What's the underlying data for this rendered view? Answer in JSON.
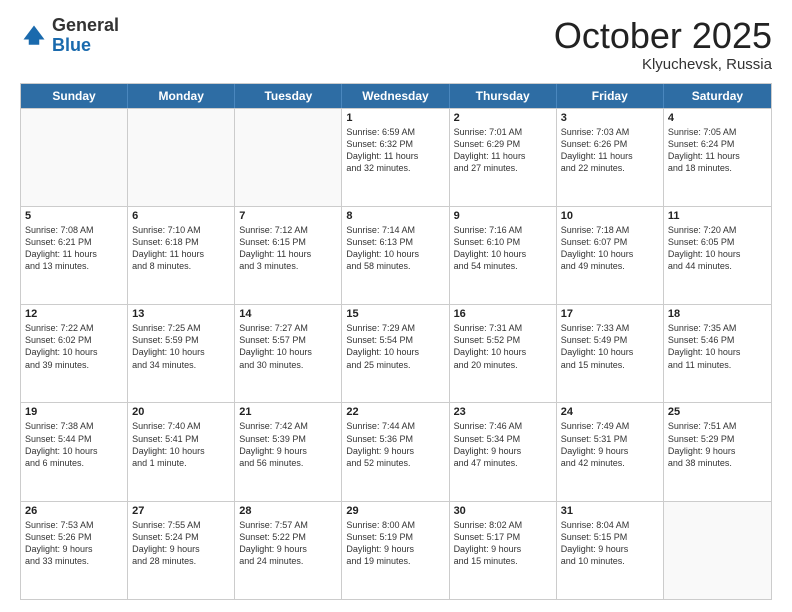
{
  "header": {
    "logo_general": "General",
    "logo_blue": "Blue",
    "month": "October 2025",
    "location": "Klyuchevsk, Russia"
  },
  "days_of_week": [
    "Sunday",
    "Monday",
    "Tuesday",
    "Wednesday",
    "Thursday",
    "Friday",
    "Saturday"
  ],
  "weeks": [
    [
      {
        "day": "",
        "text": ""
      },
      {
        "day": "",
        "text": ""
      },
      {
        "day": "",
        "text": ""
      },
      {
        "day": "1",
        "text": "Sunrise: 6:59 AM\nSunset: 6:32 PM\nDaylight: 11 hours\nand 32 minutes."
      },
      {
        "day": "2",
        "text": "Sunrise: 7:01 AM\nSunset: 6:29 PM\nDaylight: 11 hours\nand 27 minutes."
      },
      {
        "day": "3",
        "text": "Sunrise: 7:03 AM\nSunset: 6:26 PM\nDaylight: 11 hours\nand 22 minutes."
      },
      {
        "day": "4",
        "text": "Sunrise: 7:05 AM\nSunset: 6:24 PM\nDaylight: 11 hours\nand 18 minutes."
      }
    ],
    [
      {
        "day": "5",
        "text": "Sunrise: 7:08 AM\nSunset: 6:21 PM\nDaylight: 11 hours\nand 13 minutes."
      },
      {
        "day": "6",
        "text": "Sunrise: 7:10 AM\nSunset: 6:18 PM\nDaylight: 11 hours\nand 8 minutes."
      },
      {
        "day": "7",
        "text": "Sunrise: 7:12 AM\nSunset: 6:15 PM\nDaylight: 11 hours\nand 3 minutes."
      },
      {
        "day": "8",
        "text": "Sunrise: 7:14 AM\nSunset: 6:13 PM\nDaylight: 10 hours\nand 58 minutes."
      },
      {
        "day": "9",
        "text": "Sunrise: 7:16 AM\nSunset: 6:10 PM\nDaylight: 10 hours\nand 54 minutes."
      },
      {
        "day": "10",
        "text": "Sunrise: 7:18 AM\nSunset: 6:07 PM\nDaylight: 10 hours\nand 49 minutes."
      },
      {
        "day": "11",
        "text": "Sunrise: 7:20 AM\nSunset: 6:05 PM\nDaylight: 10 hours\nand 44 minutes."
      }
    ],
    [
      {
        "day": "12",
        "text": "Sunrise: 7:22 AM\nSunset: 6:02 PM\nDaylight: 10 hours\nand 39 minutes."
      },
      {
        "day": "13",
        "text": "Sunrise: 7:25 AM\nSunset: 5:59 PM\nDaylight: 10 hours\nand 34 minutes."
      },
      {
        "day": "14",
        "text": "Sunrise: 7:27 AM\nSunset: 5:57 PM\nDaylight: 10 hours\nand 30 minutes."
      },
      {
        "day": "15",
        "text": "Sunrise: 7:29 AM\nSunset: 5:54 PM\nDaylight: 10 hours\nand 25 minutes."
      },
      {
        "day": "16",
        "text": "Sunrise: 7:31 AM\nSunset: 5:52 PM\nDaylight: 10 hours\nand 20 minutes."
      },
      {
        "day": "17",
        "text": "Sunrise: 7:33 AM\nSunset: 5:49 PM\nDaylight: 10 hours\nand 15 minutes."
      },
      {
        "day": "18",
        "text": "Sunrise: 7:35 AM\nSunset: 5:46 PM\nDaylight: 10 hours\nand 11 minutes."
      }
    ],
    [
      {
        "day": "19",
        "text": "Sunrise: 7:38 AM\nSunset: 5:44 PM\nDaylight: 10 hours\nand 6 minutes."
      },
      {
        "day": "20",
        "text": "Sunrise: 7:40 AM\nSunset: 5:41 PM\nDaylight: 10 hours\nand 1 minute."
      },
      {
        "day": "21",
        "text": "Sunrise: 7:42 AM\nSunset: 5:39 PM\nDaylight: 9 hours\nand 56 minutes."
      },
      {
        "day": "22",
        "text": "Sunrise: 7:44 AM\nSunset: 5:36 PM\nDaylight: 9 hours\nand 52 minutes."
      },
      {
        "day": "23",
        "text": "Sunrise: 7:46 AM\nSunset: 5:34 PM\nDaylight: 9 hours\nand 47 minutes."
      },
      {
        "day": "24",
        "text": "Sunrise: 7:49 AM\nSunset: 5:31 PM\nDaylight: 9 hours\nand 42 minutes."
      },
      {
        "day": "25",
        "text": "Sunrise: 7:51 AM\nSunset: 5:29 PM\nDaylight: 9 hours\nand 38 minutes."
      }
    ],
    [
      {
        "day": "26",
        "text": "Sunrise: 7:53 AM\nSunset: 5:26 PM\nDaylight: 9 hours\nand 33 minutes."
      },
      {
        "day": "27",
        "text": "Sunrise: 7:55 AM\nSunset: 5:24 PM\nDaylight: 9 hours\nand 28 minutes."
      },
      {
        "day": "28",
        "text": "Sunrise: 7:57 AM\nSunset: 5:22 PM\nDaylight: 9 hours\nand 24 minutes."
      },
      {
        "day": "29",
        "text": "Sunrise: 8:00 AM\nSunset: 5:19 PM\nDaylight: 9 hours\nand 19 minutes."
      },
      {
        "day": "30",
        "text": "Sunrise: 8:02 AM\nSunset: 5:17 PM\nDaylight: 9 hours\nand 15 minutes."
      },
      {
        "day": "31",
        "text": "Sunrise: 8:04 AM\nSunset: 5:15 PM\nDaylight: 9 hours\nand 10 minutes."
      },
      {
        "day": "",
        "text": ""
      }
    ]
  ]
}
